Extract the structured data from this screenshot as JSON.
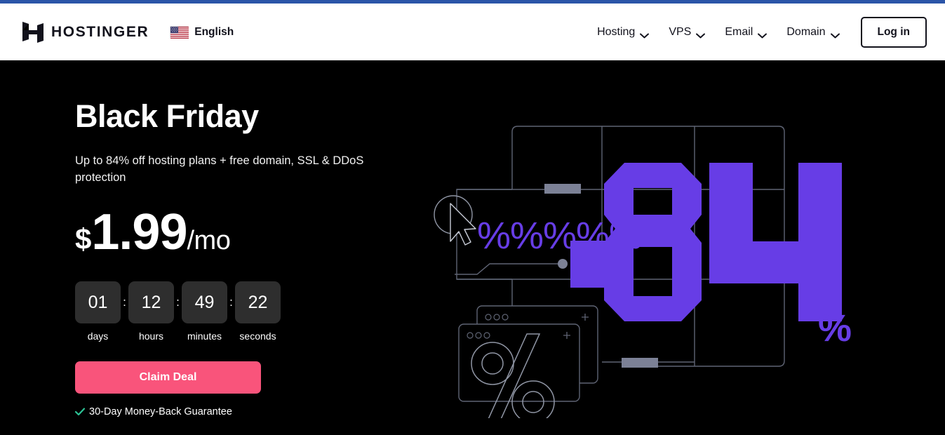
{
  "browser": {
    "accent_color": "#2B55A8"
  },
  "header": {
    "logo_icon": "hostinger-h-logo-icon",
    "brand": "HOSTINGER",
    "language": {
      "flag_icon": "us-flag-icon",
      "label": "English"
    },
    "nav": [
      {
        "label": "Hosting",
        "icon": "chevron-down-icon"
      },
      {
        "label": "VPS",
        "icon": "chevron-down-icon"
      },
      {
        "label": "Email",
        "icon": "chevron-down-icon"
      },
      {
        "label": "Domain",
        "icon": "chevron-down-icon"
      }
    ],
    "login_label": "Log in"
  },
  "hero": {
    "title": "Black Friday",
    "subtitle": "Up to 84% off hosting plans + free domain, SSL & DDoS protection",
    "price": {
      "currency": "$",
      "amount": "1.99",
      "period": "/mo"
    },
    "countdown": {
      "separator": ":",
      "units": [
        {
          "value": "01",
          "label": "days"
        },
        {
          "value": "12",
          "label": "hours"
        },
        {
          "value": "49",
          "label": "minutes"
        },
        {
          "value": "22",
          "label": "seconds"
        }
      ]
    },
    "cta_label": "Claim Deal",
    "guarantee": {
      "icon": "check-icon",
      "text": "30-Day Money-Back Guarantee"
    }
  },
  "illustration": {
    "discount_number": "84",
    "percent_symbol": "%",
    "percent_row": "%%%%%",
    "big_percent_glyph": "%",
    "cursor_icon": "mouse-cursor-icon",
    "window_icon": "browser-window-icon"
  },
  "colors": {
    "background": "#000000",
    "header_bg": "#FFFFFF",
    "text_dark": "#12121C",
    "purple": "#673DE6",
    "pink": "#F9547B",
    "green": "#2CC295",
    "countdown_box": "#2E2E2E",
    "line_gray": "#5F6474",
    "block_gray": "#7C8196"
  }
}
